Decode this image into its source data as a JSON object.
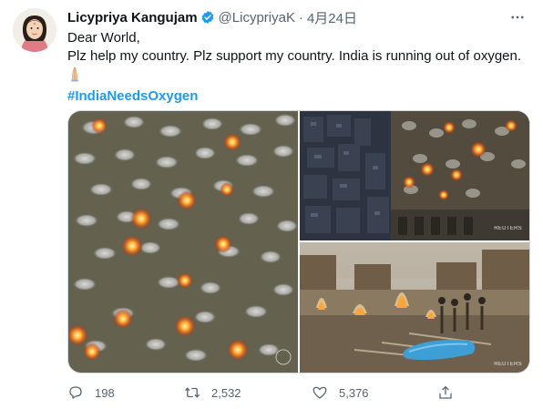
{
  "author": {
    "name": "Licypriya Kangujam",
    "handle": "@LicypriyaK",
    "separator": "·",
    "date": "4月24日"
  },
  "tweet": {
    "line1": "Dear World,",
    "line2": "Plz help my country. Plz support my country. India is running out of oxygen.",
    "hashtag": "#IndiaNeedsOxygen"
  },
  "media": {
    "watermark_top_right": "REUTERS",
    "watermark_bottom_right": "REUTERS"
  },
  "actions": {
    "replies": "198",
    "retweets": "2,532",
    "likes": "5,376"
  },
  "colors": {
    "accent": "#1d9bf0",
    "secondary_text": "#536471",
    "border": "#cfd9de"
  },
  "icons": [
    "verified-badge-icon",
    "more-icon",
    "folded-hands-emoji",
    "reply-icon",
    "retweet-icon",
    "like-icon",
    "share-icon"
  ]
}
